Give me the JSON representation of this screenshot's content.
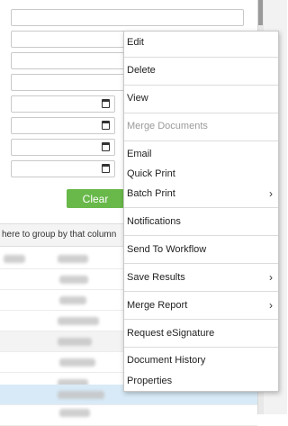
{
  "search_form": {
    "clear_label": "Clear",
    "clear_color": "#68b84a"
  },
  "grid": {
    "group_hint": "here to group by that column"
  },
  "context_menu": {
    "edit": "Edit",
    "delete": "Delete",
    "view": "View",
    "merge_documents": "Merge Documents",
    "email": "Email",
    "quick_print": "Quick Print",
    "batch_print": "Batch Print",
    "notifications": "Notifications",
    "send_to_workflow": "Send To Workflow",
    "save_results": "Save Results",
    "merge_report": "Merge Report",
    "request_esignature": "Request eSignature",
    "document_history": "Document History",
    "properties": "Properties",
    "submenu_icon": "chevron-right-icon",
    "disabled_color": "#9a9a9a"
  }
}
